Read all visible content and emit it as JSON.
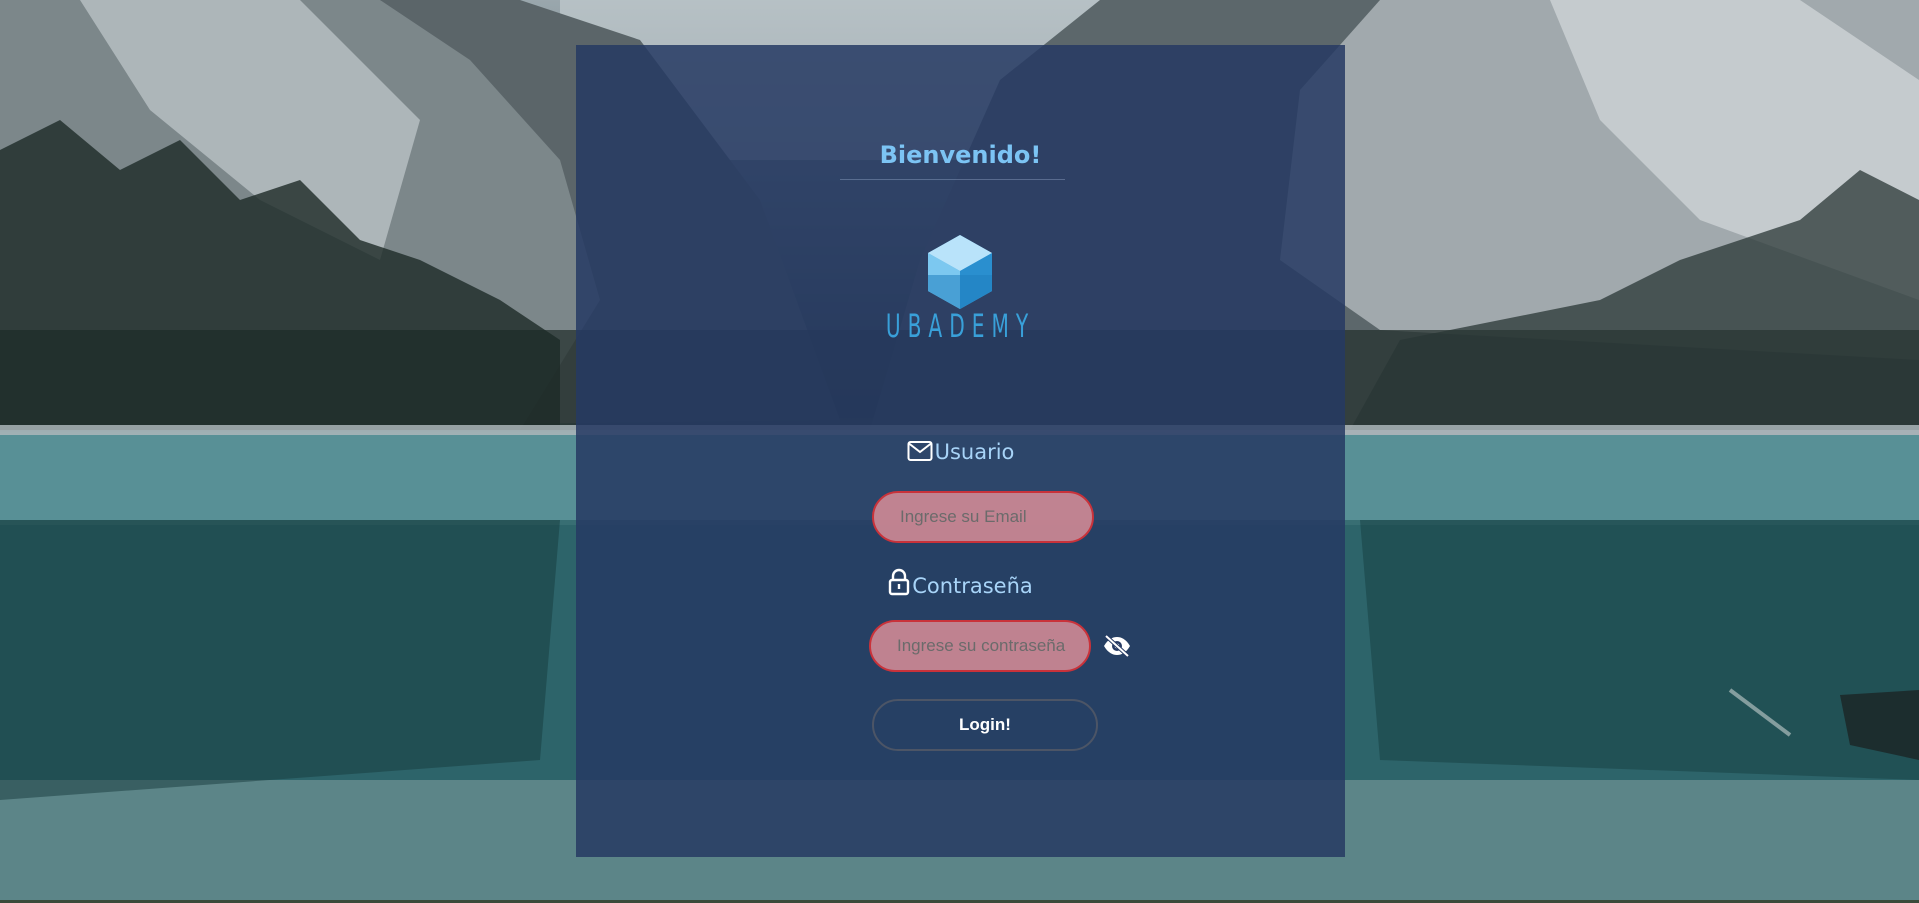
{
  "header": {
    "welcome": "Bienvenido!"
  },
  "logo": {
    "text": "UBADEMY",
    "icon": "hexagon-cube-logo"
  },
  "form": {
    "user_label": "Usuario",
    "user_icon": "envelope-icon",
    "email_placeholder": "Ingrese su Email",
    "email_value": "",
    "password_label": "Contraseña",
    "password_icon": "lock-icon",
    "password_placeholder": "Ingrese su contraseña",
    "password_value": "",
    "toggle_icon": "eye-slash-icon",
    "login_label": "Login!"
  },
  "colors": {
    "card": "#263a63",
    "accent": "#7cc4f4",
    "label": "#a8d4f8",
    "input_error_border": "#c9323a",
    "input_fill": "#db8e98",
    "logo_blue": "#39a0d9"
  }
}
